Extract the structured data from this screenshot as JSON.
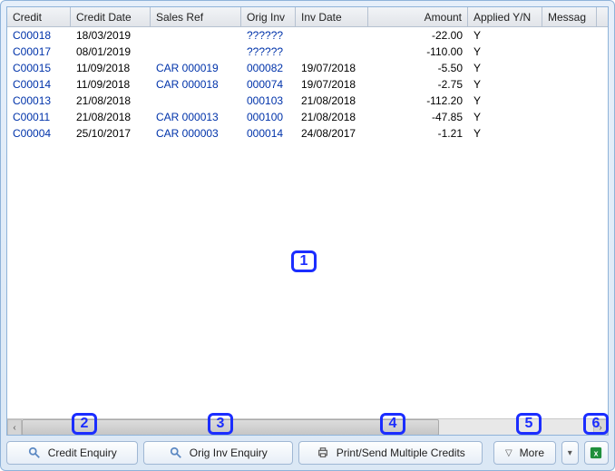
{
  "columns": {
    "credit": "Credit",
    "credit_date": "Credit Date",
    "sales_ref": "Sales Ref",
    "orig_inv": "Orig Inv",
    "inv_date": "Inv Date",
    "amount": "Amount",
    "applied": "Applied Y/N",
    "message": "Messag"
  },
  "rows": [
    {
      "credit": "C00018",
      "credit_date": "18/03/2019",
      "sales_ref": "",
      "orig_inv": "??????",
      "inv_date": "",
      "amount": "-22.00",
      "applied": "Y"
    },
    {
      "credit": "C00017",
      "credit_date": "08/01/2019",
      "sales_ref": "",
      "orig_inv": "??????",
      "inv_date": "",
      "amount": "-110.00",
      "applied": "Y"
    },
    {
      "credit": "C00015",
      "credit_date": "11/09/2018",
      "sales_ref": "CAR 000019",
      "orig_inv": "000082",
      "inv_date": "19/07/2018",
      "amount": "-5.50",
      "applied": "Y"
    },
    {
      "credit": "C00014",
      "credit_date": "11/09/2018",
      "sales_ref": "CAR 000018",
      "orig_inv": "000074",
      "inv_date": "19/07/2018",
      "amount": "-2.75",
      "applied": "Y"
    },
    {
      "credit": "C00013",
      "credit_date": "21/08/2018",
      "sales_ref": "",
      "orig_inv": "000103",
      "inv_date": "21/08/2018",
      "amount": "-112.20",
      "applied": "Y"
    },
    {
      "credit": "C00011",
      "credit_date": "21/08/2018",
      "sales_ref": "CAR 000013",
      "orig_inv": "000100",
      "inv_date": "21/08/2018",
      "amount": "-47.85",
      "applied": "Y"
    },
    {
      "credit": "C00004",
      "credit_date": "25/10/2017",
      "sales_ref": "CAR 000003",
      "orig_inv": "000014",
      "inv_date": "24/08/2017",
      "amount": "-1.21",
      "applied": "Y"
    }
  ],
  "callouts": {
    "c1": "1",
    "c2": "2",
    "c3": "3",
    "c4": "4",
    "c5": "5",
    "c6": "6"
  },
  "toolbar": {
    "credit_enquiry": "Credit Enquiry",
    "orig_inv_enquiry": "Orig Inv Enquiry",
    "print_multi": "Print/Send Multiple Credits",
    "more": "More"
  }
}
